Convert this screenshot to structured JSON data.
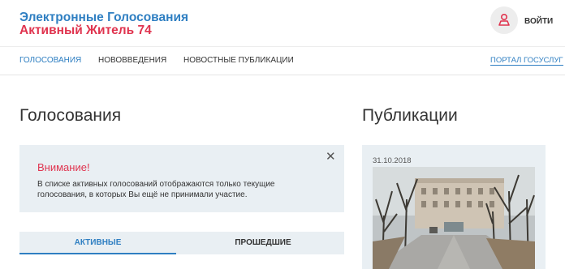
{
  "header": {
    "logo_line1": "Электронные Голосования",
    "logo_line2": "Активный Житель 74",
    "login_label": "ВОЙТИ"
  },
  "nav": {
    "items": [
      {
        "label": "ГОЛОСОВАНИЯ",
        "active": true
      },
      {
        "label": "НОВОВВЕДЕНИЯ",
        "active": false
      },
      {
        "label": "НОВОСТНЫЕ ПУБЛИКАЦИИ",
        "active": false
      }
    ],
    "portal_link": "ПОРТАЛ ГОСУСЛУГ"
  },
  "votes": {
    "heading": "Голосования",
    "alert": {
      "title": "Внимание!",
      "text": "В списке активных голосований отображаются только текущие голосования, в которых Вы ещё не принимали участие.",
      "close_icon": "close-icon"
    },
    "tabs": [
      {
        "label": "АКТИВНЫЕ",
        "active": true
      },
      {
        "label": "ПРОШЕДШИЕ",
        "active": false
      }
    ]
  },
  "publications": {
    "heading": "Публикации",
    "items": [
      {
        "date": "31.10.2018",
        "image": "park-photo"
      }
    ]
  },
  "colors": {
    "brand_blue": "#2f7fc2",
    "brand_red": "#e0344f",
    "panel_bg": "#e9eff3"
  }
}
